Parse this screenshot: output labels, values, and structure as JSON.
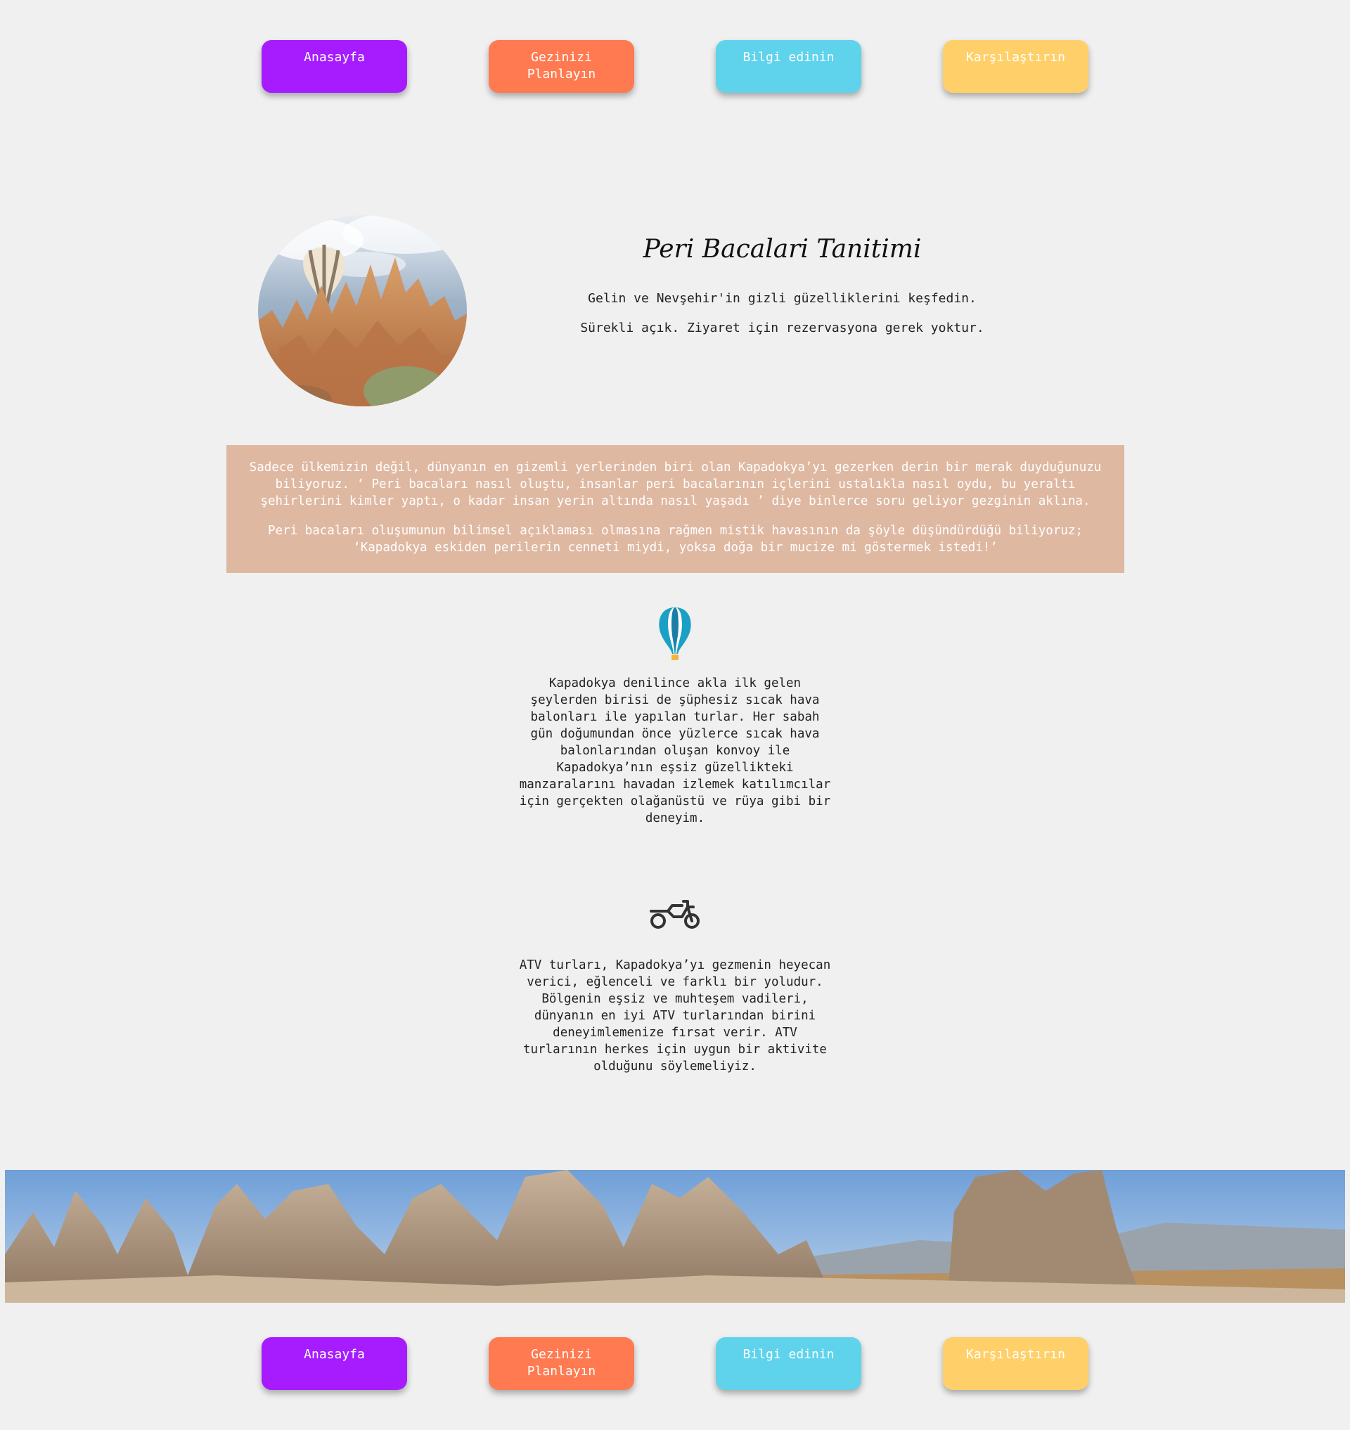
{
  "nav": {
    "home": "Anasayfa",
    "plan": "Gezinizi Planlayın",
    "info": "Bilgi edinin",
    "compare": "Karşılaştırın"
  },
  "hero": {
    "title": "Peri Bacalari Tanitimi",
    "line1": "Gelin ve Nevşehir'in gizli güzelliklerini keşfedin.",
    "line2": "Sürekli açık. Ziyaret için rezervasyona gerek yoktur."
  },
  "intro": {
    "p1": "Sadece ülkemizin değil, dünyanın en gizemli yerlerinden biri olan Kapadokya’yı gezerken derin bir merak duyduğunuzu biliyoruz. ‘ Peri bacaları nasıl oluştu, insanlar peri bacalarının içlerini ustalıkla nasıl oydu, bu yeraltı şehirlerini kimler yaptı, o kadar insan yerin altında nasıl yaşadı ’ diye binlerce soru geliyor gezginin aklına.",
    "p2": "Peri bacaları oluşumunun bilimsel açıklaması olmasına rağmen mistik havasının da şöyle düşündürdüğü biliyoruz; ‘Kapadokya eskiden perilerin cenneti miydi, yoksa doğa bir mucize mi göstermek istedi!’"
  },
  "features": {
    "balloon": "Kapadokya denilince akla ilk gelen şeylerden birisi de şüphesiz sıcak hava balonları ile yapılan turlar. Her sabah gün doğumundan önce yüzlerce sıcak hava balonlarından oluşan konvoy ile Kapadokya’nın eşsiz güzellikteki manzaralarını havadan izlemek katılımcılar için gerçekten olağanüstü ve rüya gibi bir deneyim.",
    "atv": "ATV turları, Kapadokya’yı gezmenin heyecan verici, eğlenceli ve farklı bir yoludur. Bölgenin eşsiz ve muhteşem vadileri, dünyanın en iyi ATV turlarından birini deneyimlemenize fırsat verir. ATV turlarının herkes için uygun bir aktivite olduğunu söylemeliyiz."
  },
  "icons": {
    "balloon": "hot-air-balloon-icon",
    "atv": "motorcycle-icon"
  },
  "colors": {
    "background": "#f0f0f0",
    "home_button": "#a61cff",
    "plan_button": "#ff7a50",
    "info_button": "#5fd3ec",
    "compare_button": "#ffd06a",
    "intro_box": "#dfb8a2"
  }
}
